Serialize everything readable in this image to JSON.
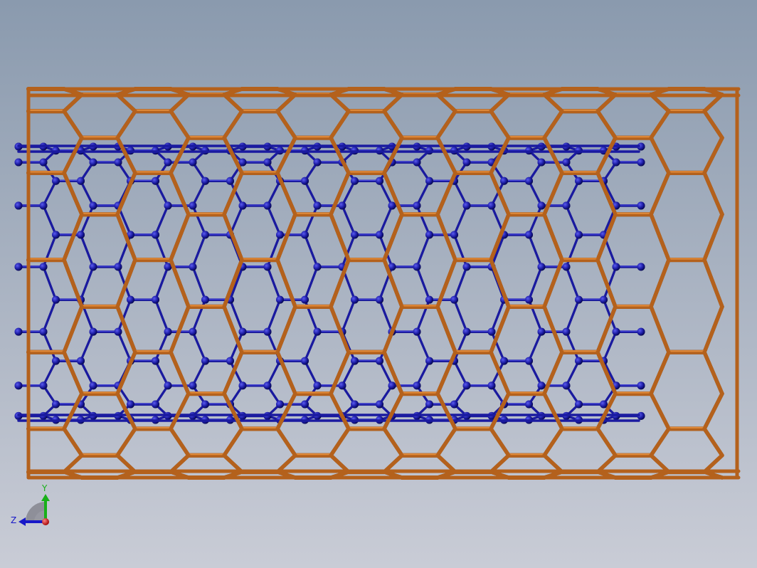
{
  "viewport": {
    "background_top": "#8a9aae",
    "background_bottom": "#c9ccd6"
  },
  "model": {
    "outer_tube": {
      "name": "outer-nanotube",
      "color": "#b4611c",
      "highlight": "#e08a3a",
      "shadow": "#6e3608"
    },
    "inner_tube": {
      "name": "inner-nanotube",
      "color": "#1a1aa0",
      "highlight": "#4a4ae0",
      "shadow": "#08085a"
    }
  },
  "triad": {
    "y_label": "Y",
    "z_label": "Z",
    "y_color": "#18b018",
    "z_color": "#1818c8",
    "x_color": "#d01818"
  }
}
